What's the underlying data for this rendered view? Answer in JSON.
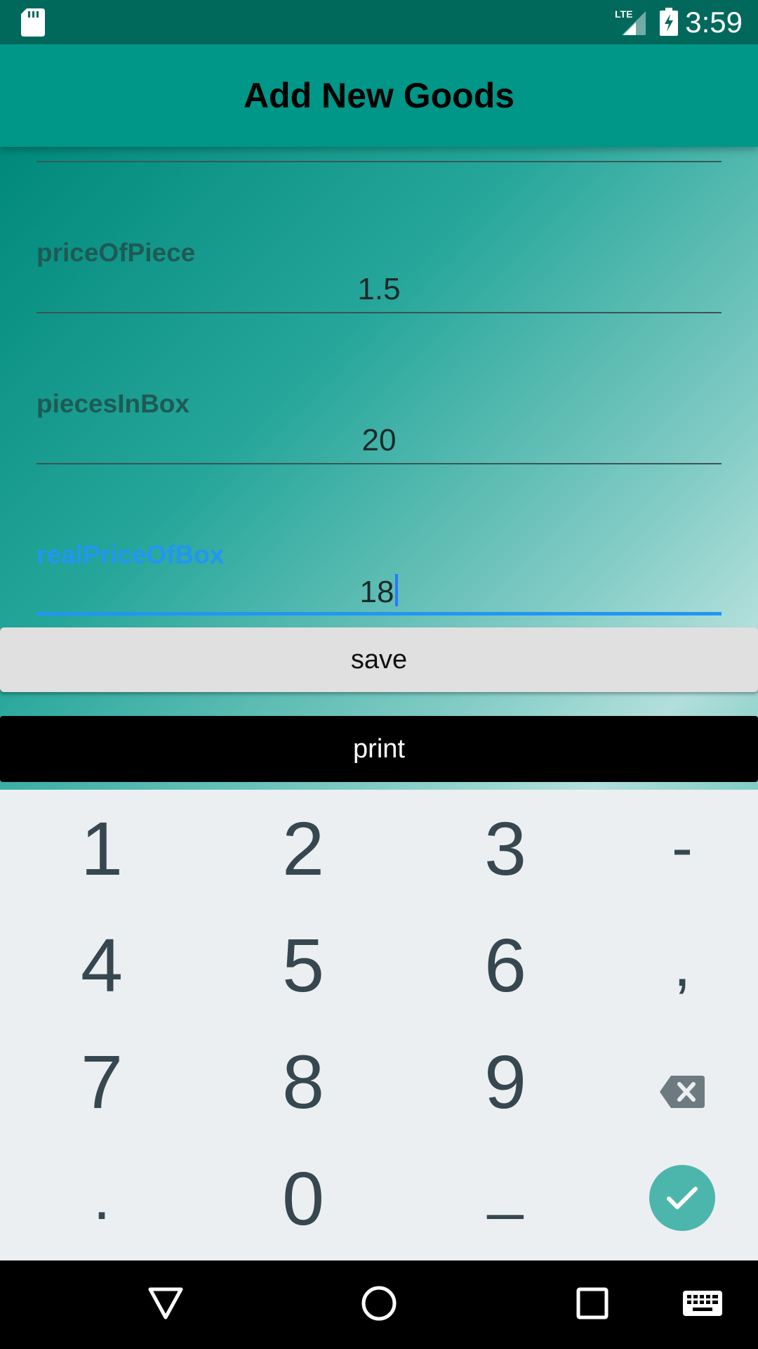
{
  "status_bar": {
    "time": "3:59",
    "network": "LTE",
    "icons": [
      "sd-card-icon",
      "lte-signal-icon",
      "battery-charging-icon"
    ]
  },
  "app_bar": {
    "title": "Add New Goods"
  },
  "form": {
    "fields": [
      {
        "label": "priceOfPiece",
        "value": "1.5",
        "focused": false
      },
      {
        "label": "piecesInBox",
        "value": "20",
        "focused": false
      },
      {
        "label": "realPriceOfBox",
        "value": "18",
        "focused": true
      }
    ],
    "save_label": "save",
    "print_label": "print"
  },
  "keyboard": {
    "rows": [
      [
        "1",
        "2",
        "3",
        "-"
      ],
      [
        "4",
        "5",
        "6",
        ","
      ],
      [
        "7",
        "8",
        "9",
        "backspace-icon"
      ],
      [
        ".",
        "0",
        "_",
        "enter-check-icon"
      ]
    ]
  },
  "nav_bar": {
    "buttons": [
      "back-triangle-icon",
      "home-circle-icon",
      "recents-square-icon",
      "keyboard-switch-icon"
    ]
  },
  "colors": {
    "status_bar": "#00695c",
    "app_bar": "#009688",
    "focus_accent": "#2196f3",
    "enter_key": "#4db6ac",
    "keyboard_bg": "#eceff1"
  }
}
